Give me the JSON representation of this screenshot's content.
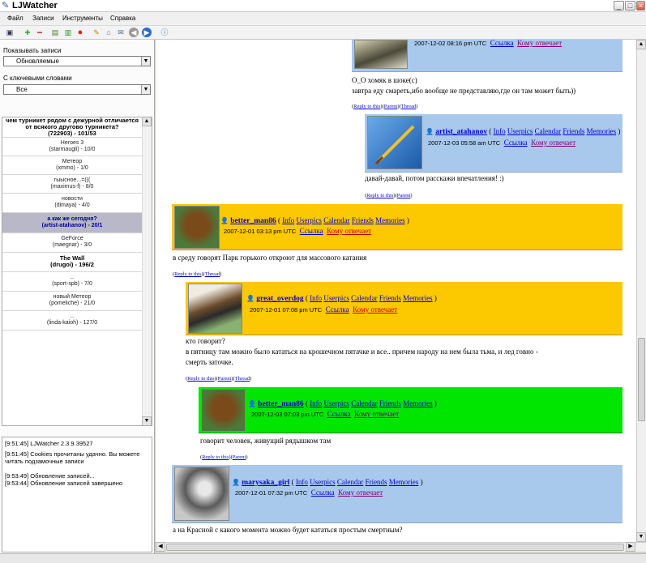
{
  "window": {
    "title": "LJWatcher",
    "controls": [
      "_",
      "□",
      "×"
    ]
  },
  "menu": [
    "Файл",
    "Записи",
    "Инструменты",
    "Справка"
  ],
  "toolbar": {
    "icons": [
      "save-icon",
      "add-icon",
      "remove-icon",
      "page-icon",
      "page-green-icon",
      "stop-icon",
      "edit-icon",
      "folder-icon",
      "mail-icon",
      "back-icon",
      "forward-icon",
      "info-icon"
    ]
  },
  "filters": {
    "show_label": "Показывать записи",
    "show_value": "Обновляемые",
    "keywords_label": "С ключевыми словами",
    "keywords_value": "Все"
  },
  "posts": [
    {
      "title": "чем турникет рядом с дежурной отличается от всякого другово турникета?",
      "info": "(722903) - 101/53",
      "bold": true,
      "selected": false
    },
    {
      "title": "Heroes 3",
      "info": "(starmaugli) - 10/0",
      "bold": false,
      "selected": false
    },
    {
      "title": "Метеор",
      "info": "(xmmo) - 1/0",
      "bold": false,
      "selected": false
    },
    {
      "title": "гыысное...=(((",
      "info": "(maximus-f) - 8/0",
      "bold": false,
      "selected": false
    },
    {
      "title": "новости",
      "info": "(dimaya) - 4/0",
      "bold": false,
      "selected": false
    },
    {
      "title": "а как же сегодня?",
      "info": "(artist-atahanov) - 20/1",
      "bold": true,
      "selected": true
    },
    {
      "title": "GeForce",
      "info": "(maegnar) - 3/0",
      "bold": false,
      "selected": false
    },
    {
      "title": "The Wall",
      "info": "(drugoi) - 196/2",
      "bold": true,
      "selected": false
    },
    {
      "title": "...",
      "info": "(sport-spb) - 7/0",
      "bold": false,
      "selected": false
    },
    {
      "title": "новый Метеор",
      "info": "(pomeliche) - 21/0",
      "bold": false,
      "selected": false
    },
    {
      "title": "...",
      "info": "(linda-kaioh) - 127/0",
      "bold": false,
      "selected": false
    }
  ],
  "log": [
    "[9:51:45] LJWatcher 2.3.9.39527",
    "[9:51:45] Cookies прочитаны удачно. Вы можете читать подзамочные записи",
    "[9:53:49] Обновление записей...",
    "[9:53:44] Обновление записей завершено"
  ],
  "links": {
    "info": "Info",
    "userpics": "Userpics",
    "calendar": "Calendar",
    "friends": "Friends",
    "memories": "Memories",
    "link": "Ссылка",
    "reply_to": "Кому отвечает",
    "paren_open": "(",
    "paren_close": ")"
  },
  "reply_links": {
    "reply_to_this": "Reply to this",
    "parent": "Parent",
    "thread": "Thread"
  },
  "colors": {
    "blue": "#a8c8ec",
    "yellow": "#fcc800",
    "green": "#00e600",
    "highlight": "#b8b8c8"
  },
  "comments": [
    {
      "date": "2007-12-02 08:16 pm UTC",
      "text": [
        "О_О хомяк в шоке(с)",
        "завтра еду смареть,ибо вообще не представляю,где он там может быть))"
      ]
    },
    {
      "user": "artist_atahanov",
      "date": "2007-12-03 05:58 am UTC",
      "text": [
        "давай-давай, потом расскажи впечатления! :)"
      ]
    },
    {
      "user": "better_man86",
      "date": "2007-12-01 03:13 pm UTC",
      "text": [
        "в среду говорят Парк горького откроют для массового катания"
      ]
    },
    {
      "user": "great_overdog",
      "date": "2007-12-01 07:08 pm UTC",
      "text": [
        "кто говорит?",
        "в пятницу там можно было кататься на крошечном пятачке и все.. причем народу на нем была тьма, и лед говно -",
        "смерть заточке."
      ]
    },
    {
      "user": "better_man86",
      "date": "2007-12-03 07:03 pm UTC",
      "text": [
        "говорит человек, живущий рядышком там"
      ]
    },
    {
      "user": "marysaka_girl",
      "date": "2007-12-01 07:32 pm UTC",
      "text": [
        "а на Красной с какого момента можно будет кататься простым смертным?"
      ]
    }
  ]
}
